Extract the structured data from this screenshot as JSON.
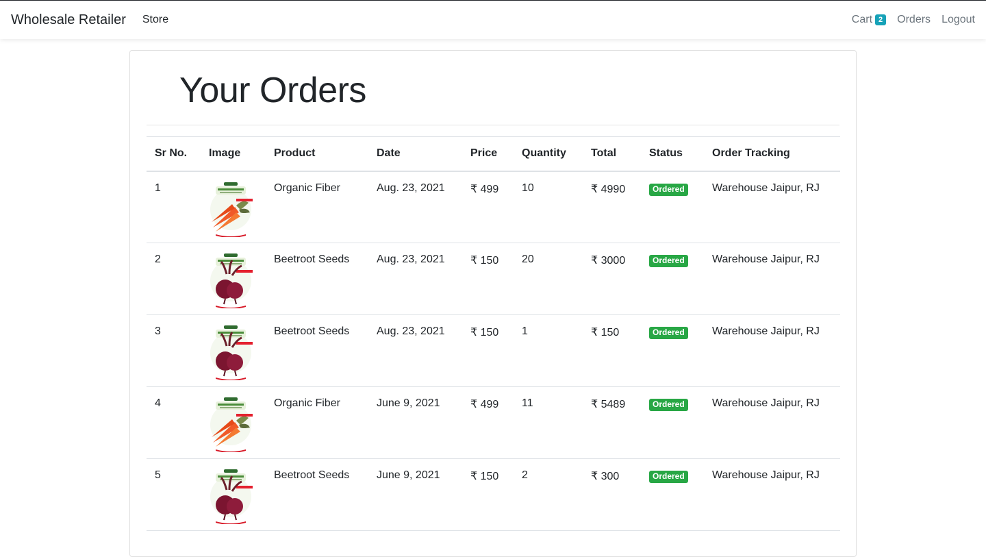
{
  "nav": {
    "brand": "Wholesale Retailer",
    "store": "Store",
    "cart": "Cart",
    "cart_count": "2",
    "orders": "Orders",
    "logout": "Logout"
  },
  "page_title": "Your Orders",
  "table": {
    "headers": [
      "Sr No.",
      "Image",
      "Product",
      "Date",
      "Price",
      "Quantity",
      "Total",
      "Status",
      "Order Tracking"
    ],
    "rows": [
      {
        "sr": "1",
        "image": "carrot-seed-packet",
        "product": "Organic Fiber",
        "date": "Aug. 23, 2021",
        "price": "₹ 499",
        "quantity": "10",
        "total": "₹ 4990",
        "status": "Ordered",
        "tracking": "Warehouse Jaipur, RJ"
      },
      {
        "sr": "2",
        "image": "beetroot-seed-packet",
        "product": "Beetroot Seeds",
        "date": "Aug. 23, 2021",
        "price": "₹ 150",
        "quantity": "20",
        "total": "₹ 3000",
        "status": "Ordered",
        "tracking": "Warehouse Jaipur, RJ"
      },
      {
        "sr": "3",
        "image": "beetroot-seed-packet",
        "product": "Beetroot Seeds",
        "date": "Aug. 23, 2021",
        "price": "₹ 150",
        "quantity": "1",
        "total": "₹ 150",
        "status": "Ordered",
        "tracking": "Warehouse Jaipur, RJ"
      },
      {
        "sr": "4",
        "image": "carrot-seed-packet",
        "product": "Organic Fiber",
        "date": "June 9, 2021",
        "price": "₹ 499",
        "quantity": "11",
        "total": "₹ 5489",
        "status": "Ordered",
        "tracking": "Warehouse Jaipur, RJ"
      },
      {
        "sr": "5",
        "image": "beetroot-seed-packet",
        "product": "Beetroot Seeds",
        "date": "June 9, 2021",
        "price": "₹ 150",
        "quantity": "2",
        "total": "₹ 300",
        "status": "Ordered",
        "tracking": "Warehouse Jaipur, RJ"
      }
    ]
  },
  "colors": {
    "status_green": "#28a745",
    "cart_badge": "#17a2b8"
  }
}
